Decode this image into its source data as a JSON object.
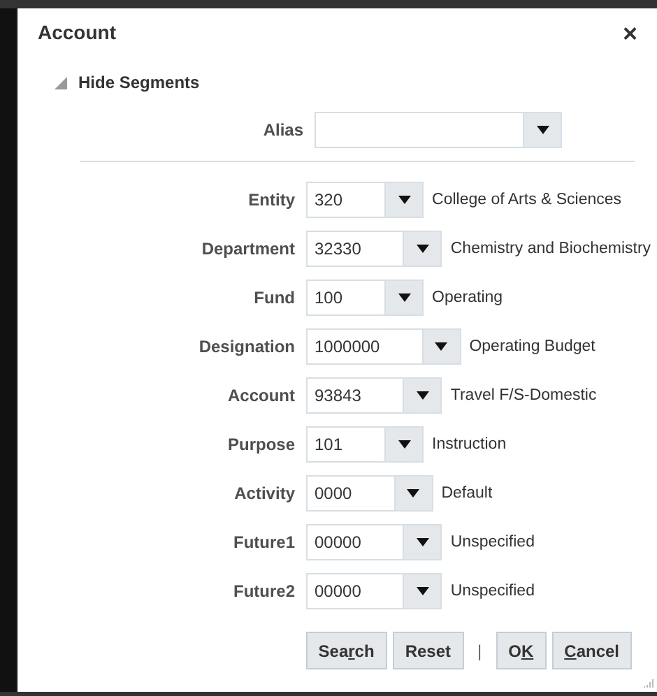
{
  "dialog": {
    "title": "Account",
    "close": "×"
  },
  "segments_toggle": {
    "label": "Hide Segments",
    "expanded": true
  },
  "alias": {
    "label": "Alias"
  },
  "segments": [
    {
      "label": "Entity",
      "value": "320",
      "description": "College of Arts & Sciences"
    },
    {
      "label": "Department",
      "value": "32330",
      "description": "Chemistry and Biochemistry"
    },
    {
      "label": "Fund",
      "value": "100",
      "description": "Operating"
    },
    {
      "label": "Designation",
      "value": "1000000",
      "description": "Operating Budget"
    },
    {
      "label": "Account",
      "value": "93843",
      "description": "Travel F/S-Domestic"
    },
    {
      "label": "Purpose",
      "value": "101",
      "description": "Instruction"
    },
    {
      "label": "Activity",
      "value": "0000",
      "description": "Default"
    },
    {
      "label": "Future1",
      "value": "00000",
      "description": "Unspecified"
    },
    {
      "label": "Future2",
      "value": "00000",
      "description": "Unspecified"
    }
  ],
  "buttons": [
    {
      "kind": "button",
      "pre": "Sea",
      "key": "r",
      "post": "ch"
    },
    {
      "kind": "button",
      "pre": "Reset"
    },
    {
      "kind": "separator",
      "pre": "|"
    },
    {
      "kind": "button",
      "pre": "O",
      "key": "K"
    },
    {
      "kind": "button",
      "key": "C",
      "post": "ancel"
    }
  ]
}
